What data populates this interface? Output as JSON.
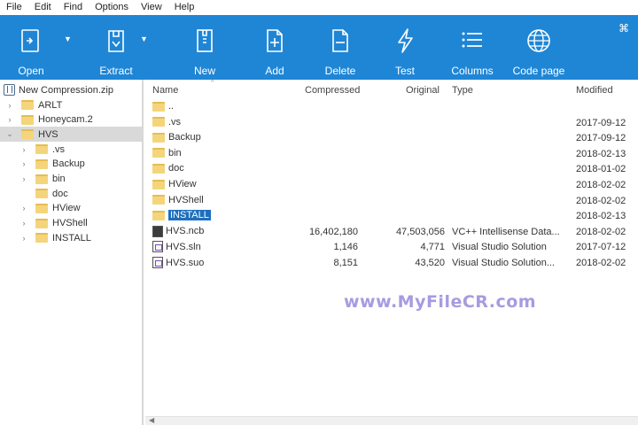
{
  "menu": [
    "File",
    "Edit",
    "Find",
    "Options",
    "View",
    "Help"
  ],
  "toolbar": {
    "buttons": [
      {
        "label": "Open",
        "icon": "open-icon"
      },
      {
        "label": "Extract",
        "icon": "extract-icon"
      },
      {
        "label": "New",
        "icon": "new-archive-icon"
      },
      {
        "label": "Add",
        "icon": "add-file-icon"
      },
      {
        "label": "Delete",
        "icon": "delete-file-icon"
      },
      {
        "label": "Test",
        "icon": "test-lightning-icon"
      },
      {
        "label": "Columns",
        "icon": "columns-icon"
      },
      {
        "label": "Code page",
        "icon": "globe-icon"
      }
    ]
  },
  "tree": {
    "root": "New Compression.zip",
    "items": [
      {
        "label": "ARLT",
        "level": 1,
        "chevron": "›"
      },
      {
        "label": "Honeycam.2",
        "level": 1,
        "chevron": "›"
      },
      {
        "label": "HVS",
        "level": 1,
        "chevron": "⌄",
        "selected": true
      },
      {
        "label": ".vs",
        "level": 2,
        "chevron": "›"
      },
      {
        "label": "Backup",
        "level": 2,
        "chevron": "›"
      },
      {
        "label": "bin",
        "level": 2,
        "chevron": "›"
      },
      {
        "label": "doc",
        "level": 2,
        "chevron": ""
      },
      {
        "label": "HView",
        "level": 2,
        "chevron": "›"
      },
      {
        "label": "HVShell",
        "level": 2,
        "chevron": "›"
      },
      {
        "label": "INSTALL",
        "level": 2,
        "chevron": "›"
      }
    ]
  },
  "columns": {
    "name": "Name",
    "compressed": "Compressed",
    "original": "Original",
    "type": "Type",
    "modified": "Modified"
  },
  "rows": [
    {
      "name": "..",
      "compressed": "",
      "original": "",
      "type": "",
      "modified": "",
      "icon": "folder"
    },
    {
      "name": ".vs",
      "compressed": "",
      "original": "",
      "type": "",
      "modified": "2017-09-12",
      "icon": "folder"
    },
    {
      "name": "Backup",
      "compressed": "",
      "original": "",
      "type": "",
      "modified": "2017-09-12",
      "icon": "folder"
    },
    {
      "name": "bin",
      "compressed": "",
      "original": "",
      "type": "",
      "modified": "2018-02-13",
      "icon": "folder"
    },
    {
      "name": "doc",
      "compressed": "",
      "original": "",
      "type": "",
      "modified": "2018-01-02",
      "icon": "folder"
    },
    {
      "name": "HView",
      "compressed": "",
      "original": "",
      "type": "",
      "modified": "2018-02-02",
      "icon": "folder"
    },
    {
      "name": "HVShell",
      "compressed": "",
      "original": "",
      "type": "",
      "modified": "2018-02-02",
      "icon": "folder"
    },
    {
      "name": "INSTALL",
      "compressed": "",
      "original": "",
      "type": "",
      "modified": "2018-02-13",
      "icon": "folder",
      "selected": true
    },
    {
      "name": "HVS.ncb",
      "compressed": "16,402,180",
      "original": "47,503,056",
      "type": "VC++ Intellisense Data...",
      "modified": "2018-02-02",
      "icon": "file-dark"
    },
    {
      "name": "HVS.sln",
      "compressed": "1,146",
      "original": "4,771",
      "type": "Visual Studio Solution",
      "modified": "2017-07-12",
      "icon": "file-sln"
    },
    {
      "name": "HVS.suo",
      "compressed": "8,151",
      "original": "43,520",
      "type": "Visual Studio Solution...",
      "modified": "2018-02-02",
      "icon": "file-sln"
    }
  ],
  "watermark": "www.MyFileCR.com",
  "colors": {
    "toolbar": "#1f86d6",
    "selection": "#1d6fbf",
    "folder": "#f4d57c",
    "watermark": "#a59ce0"
  }
}
